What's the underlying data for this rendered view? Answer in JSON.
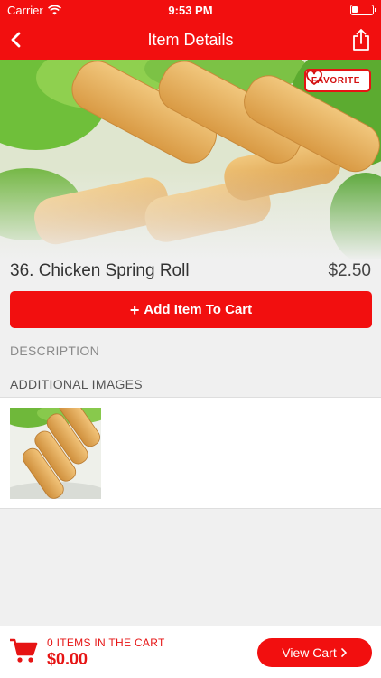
{
  "status_bar": {
    "carrier": "Carrier",
    "time": "9:53 PM"
  },
  "nav": {
    "title": "Item Details",
    "back_icon": "chevron-left-icon",
    "share_icon": "share-icon"
  },
  "item": {
    "name": "36. Chicken Spring Roll",
    "price": "$2.50",
    "favorite_label": "FAVORITE",
    "add_to_cart_label": "Add Item To Cart"
  },
  "sections": {
    "description_label": "DESCRIPTION",
    "additional_images_label": "ADDITIONAL IMAGES"
  },
  "cart": {
    "count_label": "0 ITEMS IN THE CART",
    "total": "$0.00",
    "view_cart_label": "View Cart"
  },
  "colors": {
    "brand_red": "#f20f0f",
    "text_dark": "#333333",
    "muted": "#7a7a7a",
    "background": "#f0f0f0"
  }
}
